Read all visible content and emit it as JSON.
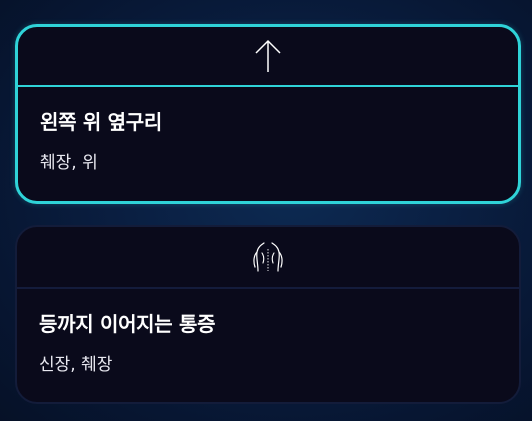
{
  "options": [
    {
      "icon": "arrow-up-icon",
      "title": "왼쪽 위 옆구리",
      "subtitle": "췌장, 위",
      "selected": true
    },
    {
      "icon": "back-torso-icon",
      "title": "등까지 이어지는 통증",
      "subtitle": "신장, 췌장",
      "selected": false
    }
  ],
  "colors": {
    "accent": "#2fd3d8",
    "card_background": "#0a0a1b",
    "page_background": "#0a1f42",
    "text": "#ffffff"
  }
}
